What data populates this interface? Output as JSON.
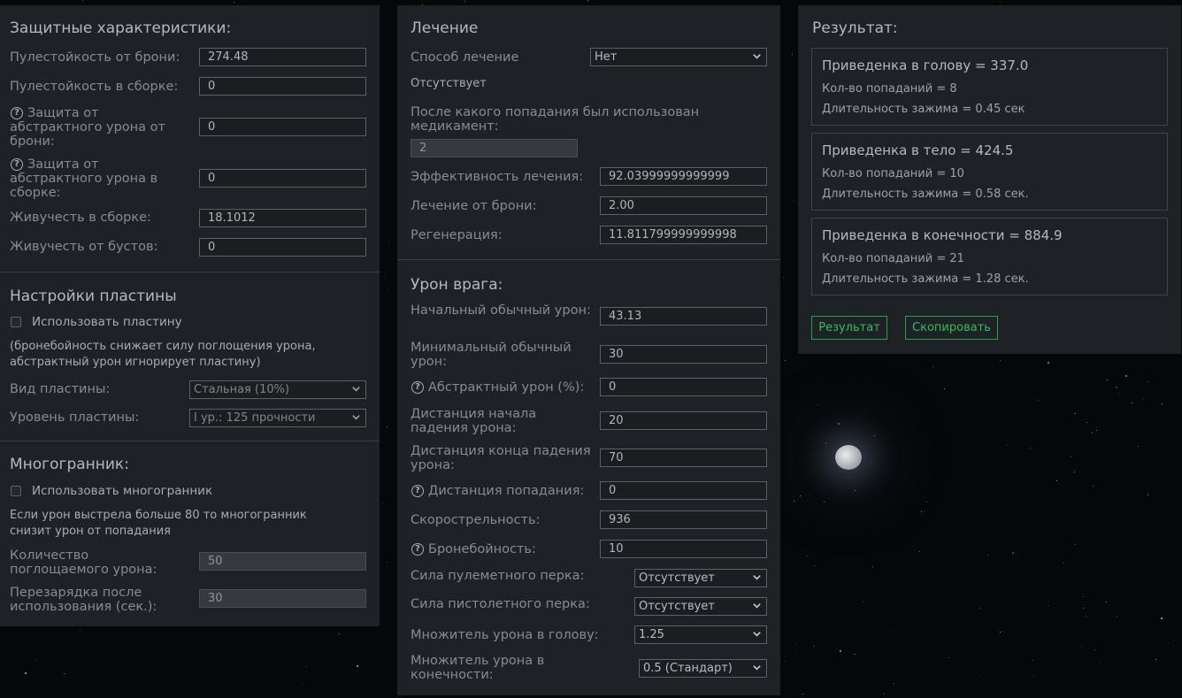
{
  "defense": {
    "title": "Защитные характеристики:",
    "armor_bulletproof_label": "Пулестойкость от брони:",
    "armor_bulletproof_value": "274.48",
    "build_bulletproof_label": "Пулестойкость в сборке:",
    "build_bulletproof_value": "0",
    "abstract_armor_label": "Защита от абстрактного урона от брони:",
    "abstract_armor_value": "0",
    "abstract_build_label": "Защита от абстрактного урона в сборке:",
    "abstract_build_value": "0",
    "vitality_build_label": "Живучесть в сборке:",
    "vitality_build_value": "18.1012",
    "vitality_boost_label": "Живучесть от бустов:",
    "vitality_boost_value": "0"
  },
  "plate": {
    "title": "Настройки пластины",
    "use_label": "Использовать пластину",
    "note": "(бронебойность снижает силу поглощения урона, абстрактный урон игнорирует пластину)",
    "type_label": "Вид пластины:",
    "type_value": "Стальная (10%)",
    "level_label": "Уровень пластины:",
    "level_value": "I ур.: 125 прочности"
  },
  "poly": {
    "title": "Многогранник:",
    "use_label": "Использовать многогранник",
    "note": "Если урон выстрела больше 80 то многогранник снизит урон от попадания",
    "absorb_label": "Количество поглощаемого урона:",
    "absorb_value": "50",
    "cooldown_label": "Перезарядка после использования (сек.):",
    "cooldown_value": "30"
  },
  "healing": {
    "title": "Лечение",
    "method_label": "Способ лечение",
    "method_value": "Нет",
    "status": "Отсутствует",
    "after_hit_label": "После какого попадания был использован медикамент:",
    "after_hit_value": "2",
    "efficiency_label": "Эффективность лечения:",
    "efficiency_value": "92.03999999999999",
    "armor_heal_label": "Лечение от брони:",
    "armor_heal_value": "2.00",
    "regen_label": "Регенерация:",
    "regen_value": "11.811799999999998"
  },
  "enemy": {
    "title": "Урон врага:",
    "start_dmg_label": "Начальный обычный урон:",
    "start_dmg_value": "43.13",
    "min_dmg_label": "Минимальный обычный урон:",
    "min_dmg_value": "30",
    "abstract_label": "Абстрактный урон (%):",
    "abstract_value": "0",
    "falloff_start_label": "Дистанция начала падения урона:",
    "falloff_start_value": "20",
    "falloff_end_label": "Дистанция конца падения урона:",
    "falloff_end_value": "70",
    "hit_dist_label": "Дистанция попадания:",
    "hit_dist_value": "0",
    "rof_label": "Скорострельность:",
    "rof_value": "936",
    "pen_label": "Бронебойность:",
    "pen_value": "10",
    "mg_perk_label": "Сила пулеметного перка:",
    "mg_perk_value": "Отсутствует",
    "pistol_perk_label": "Сила пистолетного перка:",
    "pistol_perk_value": "Отсутствует",
    "head_mult_label": "Множитель урона в голову:",
    "head_mult_value": "1.25",
    "limb_mult_label": "Множитель урона в конечности:",
    "limb_mult_value": "0.5 (Стандарт)"
  },
  "result": {
    "title": "Результат:",
    "head": {
      "title": "Приведенка в голову = 337.0",
      "hits": "Кол-во попаданий = 8",
      "duration": "Длительность зажима = 0.45 сек"
    },
    "body": {
      "title": "Приведенка в тело = 424.5",
      "hits": "Кол-во попаданий = 10",
      "duration": "Длительность зажима = 0.58 сек."
    },
    "limbs": {
      "title": "Приведенка в конечности = 884.9",
      "hits": "Кол-во попаданий = 21",
      "duration": "Длительность зажима = 1.28 сек."
    },
    "result_button": "Результат",
    "copy_button": "Скопировать"
  },
  "help_icon_glyph": "?"
}
